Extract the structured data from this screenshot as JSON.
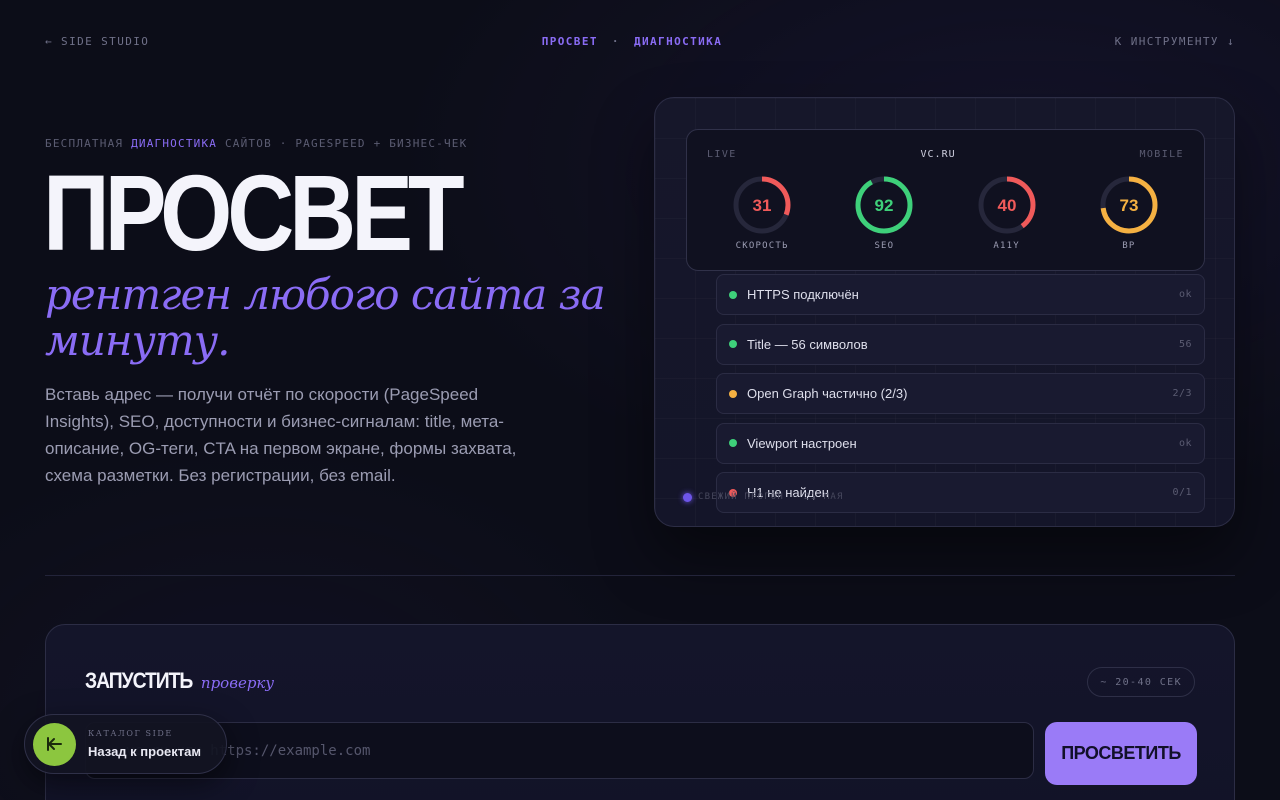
{
  "nav": {
    "back_link": "← SIDE STUDIO",
    "brand": "ПРОСВЕТ",
    "separator": "·",
    "section": "ДИАГНОСТИКА",
    "tool_link": "К ИНСТРУМЕНТУ ↓"
  },
  "hero": {
    "eyebrow_pre": "БЕСПЛАТНАЯ",
    "eyebrow_accent": "ДИАГНОСТИКА",
    "eyebrow_post": "САЙТОВ · PAGESPEED + БИЗНЕС-ЧЕК",
    "title": "ПРОСВЕТ",
    "subtitle": "рентген любого сайта за минуту.",
    "description": "Вставь адрес — получи отчёт по скорости (PageSpeed Insights), SEO, доступности и бизнес-сигналам: title, мета-описание, OG-теги, CTA на первом экране, формы захвата, схема разметки. Без регистрации, без email."
  },
  "preview": {
    "live_label": "LIVE",
    "site": "VC.RU",
    "device": "MOBILE",
    "scores": [
      {
        "label": "СКОРОСТЬ",
        "value": 31,
        "color": "#f05a5a"
      },
      {
        "label": "SEO",
        "value": 92,
        "color": "#3ed07a"
      },
      {
        "label": "A11Y",
        "value": 40,
        "color": "#f05a5a"
      },
      {
        "label": "BP",
        "value": 73,
        "color": "#f5b142"
      }
    ],
    "checks": [
      {
        "label": "HTTPS подключён",
        "value": "ok",
        "status_color": "#3ed07a"
      },
      {
        "label": "Title — 56 символов",
        "value": "56",
        "status_color": "#3ed07a"
      },
      {
        "label": "Open Graph частично (2/3)",
        "value": "2/3",
        "status_color": "#f5b142"
      },
      {
        "label": "Viewport настроен",
        "value": "ok",
        "status_color": "#3ed07a"
      },
      {
        "label": "H1 не найден",
        "value": "0/1",
        "status_color": "#f05a5a"
      }
    ],
    "fresh_label": "СВЕЖИЙ ПРОГОН · 21 МАЯ"
  },
  "run": {
    "title_strong": "ЗАПУСТИТЬ",
    "title_em": "проверку",
    "eta": "~ 20-40 СЕК",
    "input_placeholder": "vc.ru или https://example.com",
    "input_value": "",
    "submit_label": "ПРОСВЕТИТЬ"
  },
  "backpill": {
    "icon": "arrow-left-icon",
    "small_label": "КАТАЛОГ SIDE",
    "label": "Назад к проектам"
  },
  "colors": {
    "accent": "#8a6cf5",
    "button": "#9a7bf7",
    "ok": "#3ed07a",
    "warn": "#f5b142",
    "bad": "#f05a5a",
    "back_button": "#8cc63f"
  }
}
